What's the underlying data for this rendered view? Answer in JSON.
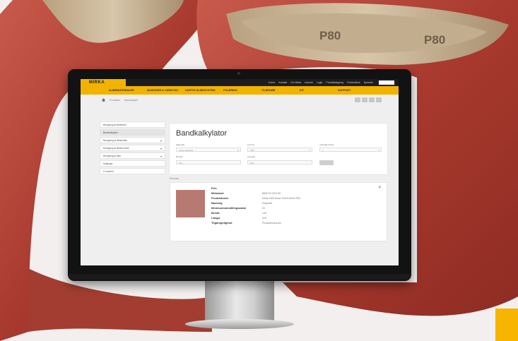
{
  "belt_prints": [
    "P80",
    "P80"
  ],
  "colors": {
    "belt": "#b5473c",
    "belt_backing": "#c9b59a",
    "brand_yellow": "#f2b300",
    "topbar": "#1d1d1d",
    "product_swatch": "#b77a73"
  },
  "site": {
    "logo": "MIRKA",
    "top_links": [
      "Home",
      "Kontakt",
      "Om Mirka",
      "Industri",
      "Login",
      "Produktsøgning",
      "Forhandlere",
      "Nyheder"
    ],
    "nav": [
      "SLIBEMATERIALER",
      "MASKINER & VÆRKTØJ",
      "HURTIG SLIBESYSTEM",
      "POLERING",
      "TILBEHØR",
      "KIT",
      "SUPPORT"
    ],
    "breadcrumbs": [
      "Produkter",
      "Bandkalkyle"
    ],
    "sidebar": [
      {
        "label": "Beregning af slibebånd",
        "active": false,
        "expandable": false
      },
      {
        "label": "Bandkalkylator",
        "active": true,
        "expandable": false
      },
      {
        "label": "Beregning af slibemidler",
        "active": false,
        "expandable": true
      },
      {
        "label": "Beregning af slibehoveder",
        "active": false,
        "expandable": true
      },
      {
        "label": "Beregning af dele",
        "active": false,
        "expandable": true
      },
      {
        "label": "Kataloger",
        "active": false,
        "expandable": false
      },
      {
        "label": "For lærere",
        "active": false,
        "expandable": false
      }
    ]
  },
  "calculator": {
    "title": "Bandkalkylator",
    "fields": {
      "material": {
        "label": "Materiale",
        "value": "Vælg materiale"
      },
      "grit": {
        "label": "Korning",
        "value": "P80"
      },
      "recommended": {
        "label": "Anbefalet bånd",
        "value": "1"
      },
      "width": {
        "label": "Bredde",
        "value": "100"
      },
      "length": {
        "label": "Længde",
        "value": "915"
      }
    }
  },
  "results": {
    "label": "Resultat",
    "rows": [
      {
        "key": "Pris",
        "value": ""
      },
      {
        "key": "Mirkakod",
        "value": "8836 02 0100 80"
      },
      {
        "key": "Produktnavn",
        "value": "Mirka 1900 Band 100x915mm P80"
      },
      {
        "key": "Backing",
        "value": "Polyester"
      },
      {
        "key": "Minimumsbestillingsantal",
        "value": "20"
      },
      {
        "key": "Bredd",
        "value": "100"
      },
      {
        "key": "Längd",
        "value": "915"
      },
      {
        "key": "Tilgængelighed",
        "value": "Produktionsordre"
      }
    ]
  }
}
